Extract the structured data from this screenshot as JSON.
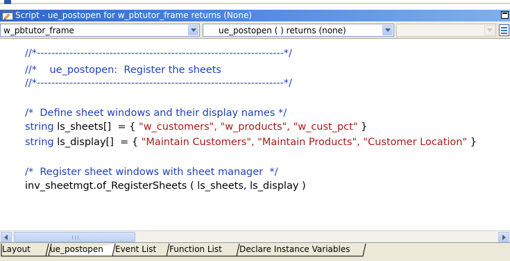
{
  "window": {
    "title": "Script - ue_postopen for w_pbtutor_frame returns (None)"
  },
  "toolbar": {
    "object_select": "w_pbtutor_frame",
    "event_select": "ue_postopen ( ) returns (none)",
    "ancestor_select": ""
  },
  "code": {
    "lines": [
      {
        "text": "//*--------------------------------------------------------------------*/",
        "kind": "comment"
      },
      {
        "text": "//*    ue_postopen:  Register the sheets",
        "kind": "comment"
      },
      {
        "text": "//*--------------------------------------------------------------------*/",
        "kind": "comment"
      },
      {
        "text": "",
        "kind": "plain"
      },
      {
        "text": "/*  Define sheet windows and their display names */",
        "kind": "comment"
      },
      {
        "keyword": "string",
        "middle": " ls_sheets[]  = { ",
        "strings": "\"w_customers\", \"w_products\", \"w_cust_pct\"",
        "end": " }",
        "kind": "decl"
      },
      {
        "keyword": "string",
        "middle": " ls_display[]  = { ",
        "strings": "\"Maintain Customers\", \"Maintain Products\", \"Customer Location\"",
        "end": " }",
        "kind": "decl"
      },
      {
        "text": "",
        "kind": "plain"
      },
      {
        "text": "/*  Register sheet windows with sheet manager  */",
        "kind": "comment"
      },
      {
        "text": "inv_sheetmgt.of_RegisterSheets ( ls_sheets, ls_display )",
        "kind": "plain"
      }
    ]
  },
  "tabs": [
    {
      "label": "Layout"
    },
    {
      "label": "ue_postopen"
    },
    {
      "label": "Event List"
    },
    {
      "label": "Function List"
    },
    {
      "label": "Declare Instance Variables"
    }
  ],
  "colors": {
    "titlebar_start": "#2f66c8",
    "comment": "#1f3fbe",
    "string": "#a8191a"
  },
  "icons": {
    "app": "script-window-icon",
    "maximize": "maximize-icon",
    "dropdown": "chevron-down-icon",
    "list": "list-view-icon",
    "scroll_left": "arrow-left-icon",
    "scroll_right": "arrow-right-icon"
  }
}
